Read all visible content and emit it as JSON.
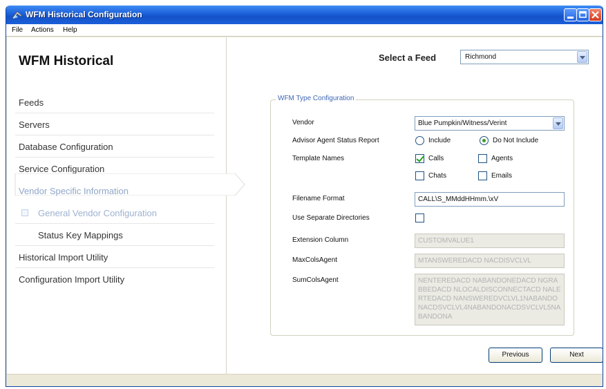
{
  "window": {
    "title": "WFM Historical Configuration",
    "accent": "#1a5fd9",
    "buttons": [
      "minimize",
      "maximize",
      "close"
    ]
  },
  "menubar": {
    "items": [
      "File",
      "Actions",
      "Help"
    ]
  },
  "sidebar": {
    "title": "WFM Historical",
    "items": [
      {
        "label": "Feeds"
      },
      {
        "label": "Servers"
      },
      {
        "label": "Database Configuration"
      },
      {
        "label": "Service Configuration"
      },
      {
        "label": "Vendor Specific Information",
        "active": true
      },
      {
        "label": "General Vendor Configuration",
        "sub": true,
        "active": true
      },
      {
        "label": "Status Key Mappings",
        "sub": true
      },
      {
        "label": "Historical Import Utility"
      },
      {
        "label": "Configuration Import Utility"
      }
    ]
  },
  "feed": {
    "label": "Select a Feed",
    "value": "Richmond"
  },
  "group": {
    "legend": "WFM Type Configuration",
    "vendor": {
      "label": "Vendor",
      "value": "Blue Pumpkin/Witness/Verint"
    },
    "advisor": {
      "label": "Advisor Agent Status Report",
      "include": "Include",
      "do_not_include": "Do Not Include",
      "selected": "Do Not Include"
    },
    "templates": {
      "label": "Template Names",
      "calls": "Calls",
      "agents": "Agents",
      "chats": "Chats",
      "emails": "Emails",
      "checked": [
        "Calls"
      ]
    },
    "filename": {
      "label": "Filename Format",
      "value": "CALL\\S_MMddHHmm.\\xV"
    },
    "separate_dirs": {
      "label": "Use Separate Directories",
      "checked": false
    },
    "extension": {
      "label": "Extension Column",
      "value": "CUSTOMVALUE1"
    },
    "maxcols": {
      "label": "MaxColsAgent",
      "value": "MTANSWEREDACD NACDISVCLVL"
    },
    "sumcols": {
      "label": "SumColsAgent",
      "value": "NENTEREDACD NABANDONEDACD NGRABBEDACD NLOCALDISCONNECTACD NALERTEDACD NANSWEREDVCLVL1NABANDONACDSVCLVL4NABANDONACDSVCLVL5NABANDONA"
    }
  },
  "buttons": {
    "previous": "Previous",
    "next": "Next"
  }
}
